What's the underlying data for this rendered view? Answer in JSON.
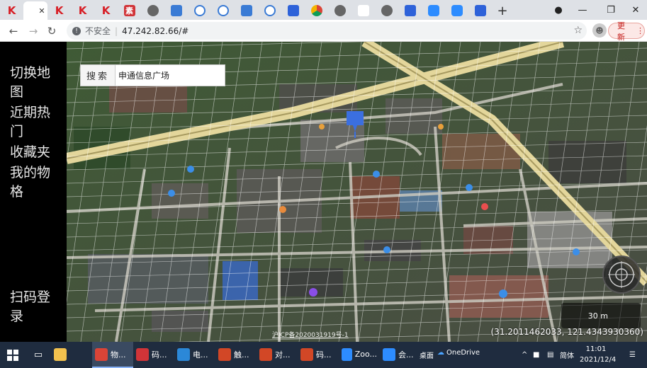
{
  "browser": {
    "tabs": [
      {
        "icon": "k-icon",
        "glyph": "K"
      },
      {
        "icon": "blank-icon",
        "glyph": "↑",
        "active": true,
        "close": "✕"
      },
      {
        "icon": "k-icon",
        "glyph": "K"
      },
      {
        "icon": "k-icon",
        "glyph": "K"
      },
      {
        "icon": "k-icon",
        "glyph": "K"
      },
      {
        "icon": "pdf-icon",
        "glyph": "素"
      },
      {
        "icon": "globe-icon",
        "glyph": ""
      },
      {
        "icon": "blue-app-icon",
        "glyph": ""
      },
      {
        "icon": "ring-icon",
        "glyph": ""
      },
      {
        "icon": "ring-icon",
        "glyph": ""
      },
      {
        "icon": "blue-app-icon",
        "glyph": ""
      },
      {
        "icon": "ring-icon",
        "glyph": ""
      },
      {
        "icon": "paw-icon",
        "glyph": ""
      },
      {
        "icon": "chrome-icon",
        "glyph": ""
      },
      {
        "icon": "globe-icon",
        "glyph": ""
      },
      {
        "icon": "map-pin-icon",
        "glyph": ""
      },
      {
        "icon": "globe-icon",
        "glyph": ""
      },
      {
        "icon": "paw-icon",
        "glyph": ""
      },
      {
        "icon": "zoom-icon",
        "glyph": ""
      },
      {
        "icon": "zoom-icon",
        "glyph": ""
      },
      {
        "icon": "paw-icon",
        "glyph": ""
      }
    ],
    "new_tab": "+",
    "address": {
      "security_label": "不安全",
      "url": "47.242.82.66/#"
    },
    "update_label": "更新"
  },
  "sidebar": {
    "items": [
      {
        "label": "切换地图"
      },
      {
        "label": "近期热门"
      },
      {
        "label": "收藏夹"
      },
      {
        "label": "我的物格"
      }
    ],
    "scan_login": "扫码登录"
  },
  "map": {
    "search": {
      "label": "搜索",
      "value": "申通信息广场"
    },
    "scale_label": "30 m",
    "coordinates": "(31.2011462033, 121.4343930360)",
    "icp": "沪ICP备2020031919号-1",
    "colors": {
      "road": "#e8d9a0",
      "grid": "#ffffff",
      "marker": "#3b6fe0"
    }
  },
  "taskbar": {
    "items": [
      {
        "icon": "explorer-icon",
        "label": ""
      },
      {
        "icon": "chrome-icon",
        "label": "物..."
      },
      {
        "icon": "pdf-icon",
        "label": "码..."
      },
      {
        "icon": "video-icon",
        "label": "电..."
      },
      {
        "icon": "ppt-icon",
        "label": "触..."
      },
      {
        "icon": "ppt-icon",
        "label": "对..."
      },
      {
        "icon": "ppt-icon",
        "label": "码..."
      },
      {
        "icon": "zoom-icon",
        "label": "Zoo..."
      },
      {
        "icon": "zoom-icon",
        "label": "会..."
      }
    ],
    "tray": {
      "desktop": "桌面",
      "onedrive": "OneDrive",
      "ime": "简体",
      "time": "11:01",
      "date": "2021/12/4"
    }
  }
}
